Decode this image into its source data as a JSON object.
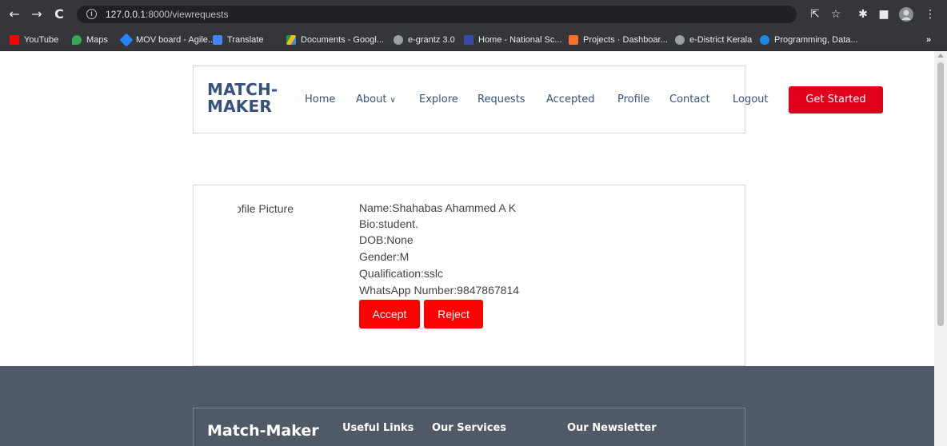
{
  "browser": {
    "url_host": "127.0.0.1",
    "url_path": ":8000/viewrequests",
    "bookmarks": [
      {
        "label": "YouTube",
        "icon": "youtube-icon",
        "color": "#ff0000"
      },
      {
        "label": "Maps",
        "icon": "maps-icon",
        "color": "#34a853"
      },
      {
        "label": "MOV board - Agile...",
        "icon": "agile-icon",
        "color": "#2684ff"
      },
      {
        "label": "Translate",
        "icon": "translate-icon",
        "color": "#4285f4"
      },
      {
        "label": "Documents - Googl...",
        "icon": "drive-icon",
        "color": "#fbbc04"
      },
      {
        "label": "e-grantz 3.0",
        "icon": "globe-icon",
        "color": "#9aa0a6"
      },
      {
        "label": "Home - National Sc...",
        "icon": "nsp-icon",
        "color": "#1a237e"
      },
      {
        "label": "Projects · Dashboar...",
        "icon": "gitlab-icon",
        "color": "#fc6d26"
      },
      {
        "label": "e-District Kerala",
        "icon": "globe-icon",
        "color": "#9aa0a6"
      },
      {
        "label": "Programming, Data...",
        "icon": "programming-icon",
        "color": "#1e88e5"
      }
    ]
  },
  "site": {
    "logo_line1": "MATCH-",
    "logo_line2": "MAKER",
    "nav": {
      "home": "Home",
      "about": "About",
      "explore": "Explore",
      "requests": "Requests",
      "accepted": "Accepted",
      "profile": "Profile",
      "contact": "Contact",
      "logout": "Logout"
    },
    "cta": "Get Started"
  },
  "request": {
    "picture_alt": "Profile Picture",
    "name": "Name:Shahabas Ahammed A K",
    "bio": "Bio:student.",
    "dob": "DOB:None",
    "gender": "Gender:M",
    "qualification": "Qualification:sslc",
    "whatsapp": "WhatsApp Number:9847867814",
    "accept": "Accept",
    "reject": "Reject"
  },
  "footer": {
    "brand": "Match-Maker",
    "useful_links": "Useful Links",
    "our_services": "Our Services",
    "newsletter": "Our Newsletter"
  },
  "colors": {
    "brand": "#37517e",
    "cta": "#e0001b",
    "action": "#ff0000",
    "footer_bg": "#505a66"
  }
}
